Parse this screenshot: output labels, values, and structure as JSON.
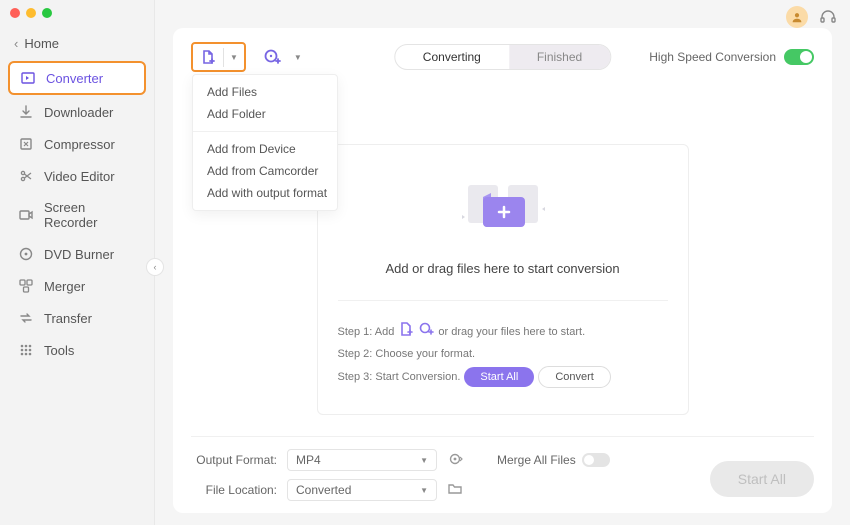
{
  "window": {
    "home": "Home"
  },
  "sidebar": {
    "items": [
      {
        "label": "Converter",
        "active": true
      },
      {
        "label": "Downloader"
      },
      {
        "label": "Compressor"
      },
      {
        "label": "Video Editor"
      },
      {
        "label": "Screen Recorder"
      },
      {
        "label": "DVD Burner"
      },
      {
        "label": "Merger"
      },
      {
        "label": "Transfer"
      },
      {
        "label": "Tools"
      }
    ]
  },
  "toolbar": {
    "dropdown": {
      "group1": [
        "Add Files",
        "Add Folder"
      ],
      "group2": [
        "Add from Device",
        "Add from Camcorder",
        "Add with output format"
      ]
    }
  },
  "tabs": {
    "converting": "Converting",
    "finished": "Finished"
  },
  "hs": {
    "label": "High Speed Conversion"
  },
  "dropzone": {
    "title": "Add or drag files here to start conversion",
    "step1_prefix": "Step 1: Add",
    "step1_suffix": "or drag your files here to start.",
    "step2": "Step 2: Choose your format.",
    "step3_prefix": "Step 3: Start Conversion.",
    "start_all": "Start  All",
    "convert": "Convert"
  },
  "footer": {
    "output_label": "Output Format:",
    "output_value": "MP4",
    "location_label": "File Location:",
    "location_value": "Converted",
    "merge_label": "Merge All Files",
    "start_all": "Start All"
  }
}
